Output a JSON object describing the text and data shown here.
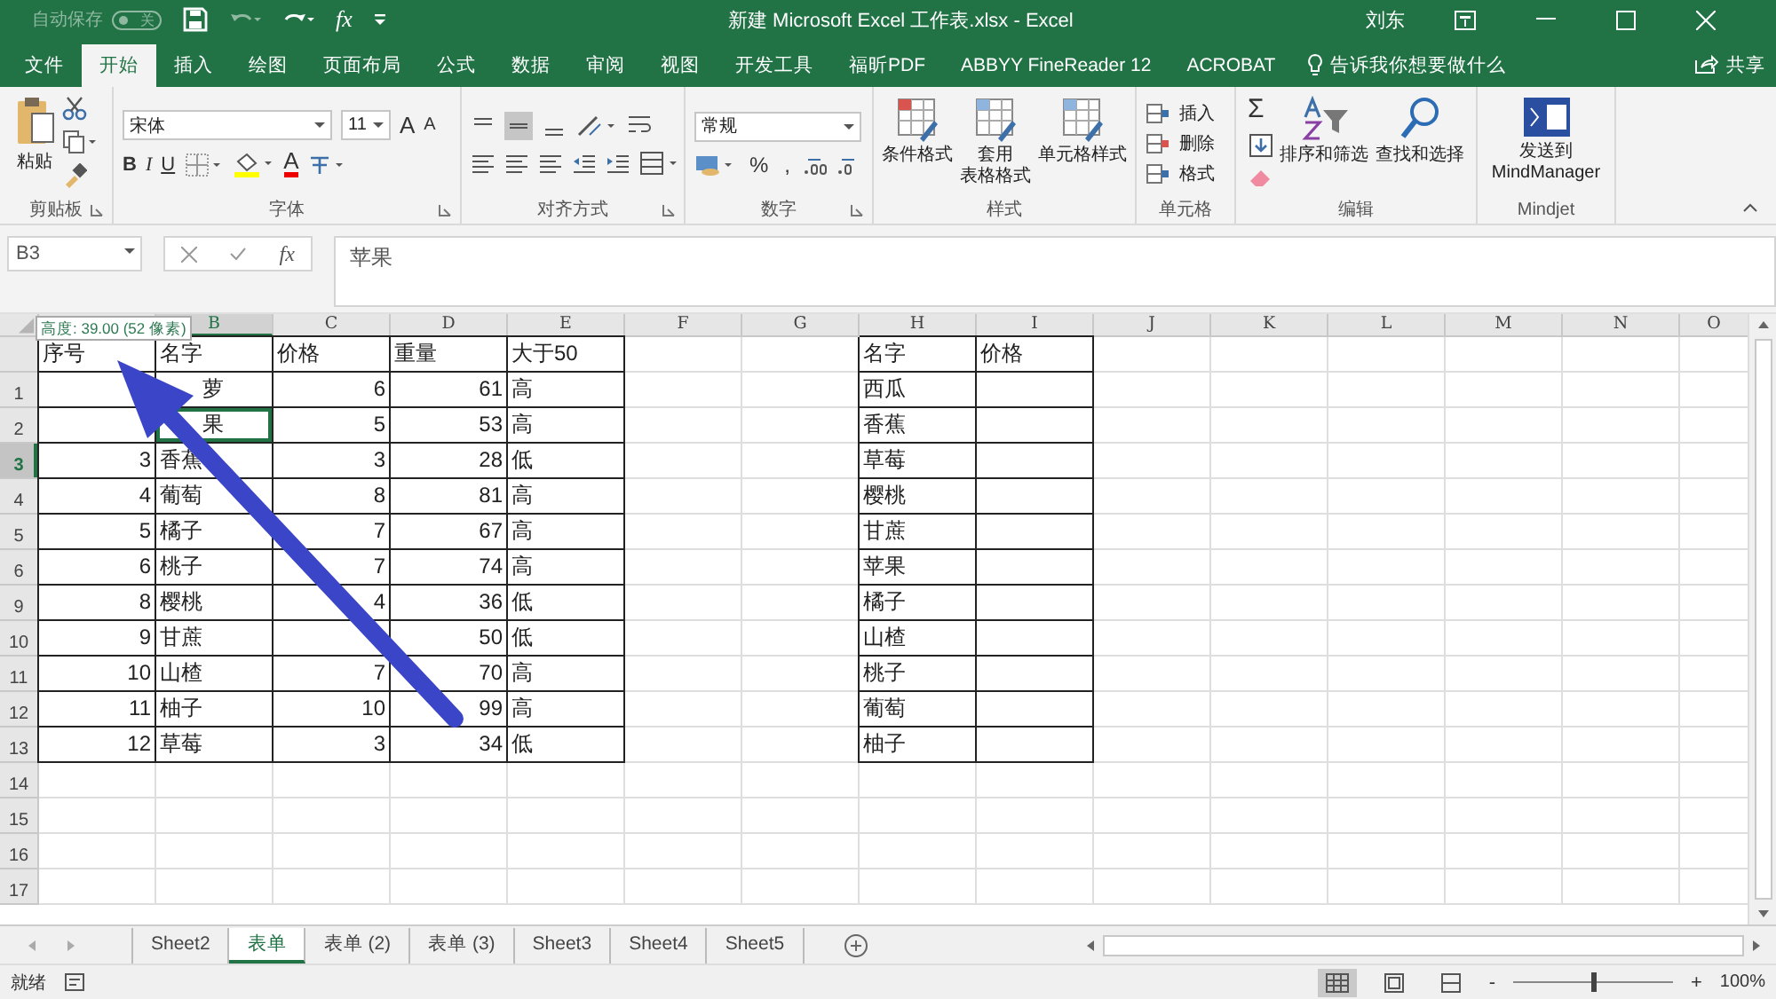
{
  "title_bar": {
    "autosave": {
      "label": "自动保存",
      "on": false,
      "switch_text": "关"
    },
    "fx": "fx",
    "title": "新建 Microsoft Excel 工作表.xlsx  -  Excel",
    "user": "刘东"
  },
  "ribbon_tabs": [
    {
      "label": "文件",
      "selected": false
    },
    {
      "label": "开始",
      "selected": true
    },
    {
      "label": "插入",
      "selected": false
    },
    {
      "label": "绘图",
      "selected": false
    },
    {
      "label": "页面布局",
      "selected": false
    },
    {
      "label": "公式",
      "selected": false
    },
    {
      "label": "数据",
      "selected": false
    },
    {
      "label": "审阅",
      "selected": false
    },
    {
      "label": "视图",
      "selected": false
    },
    {
      "label": "开发工具",
      "selected": false
    },
    {
      "label": "福昕PDF",
      "selected": false
    },
    {
      "label": "ABBYY FineReader 12",
      "selected": false
    },
    {
      "label": "ACROBAT",
      "selected": false
    }
  ],
  "tell_me": "告诉我你想要做什么",
  "share": "共享",
  "ribbon": {
    "clipboard": {
      "paste": "粘贴",
      "label": "剪贴板"
    },
    "font": {
      "name": "宋体",
      "size": "11",
      "grow": "A",
      "shrink": "A",
      "bold": "B",
      "italic": "I",
      "underline": "U",
      "font_color_letter": "A",
      "label": "字体"
    },
    "alignment": {
      "label": "对齐方式"
    },
    "number": {
      "format": "常规",
      "percent": "%",
      "comma": ",",
      "label": "数字"
    },
    "styles": {
      "items": [
        [
          "条件格式"
        ],
        [
          "套用",
          "表格格式"
        ],
        [
          "单元格样式"
        ]
      ],
      "label": "样式"
    },
    "cells": {
      "items": [
        "插入",
        "删除",
        "格式"
      ],
      "label": "单元格"
    },
    "editing": {
      "sum": "Σ",
      "items": [
        "排序和筛选",
        "查找和选择"
      ],
      "label": "编辑"
    },
    "mindjet": {
      "send": [
        "发送到",
        "MindManager"
      ],
      "label": "Mindjet"
    }
  },
  "formula_bar": {
    "name_box": "B3",
    "fx": "fx",
    "formula": "苹果"
  },
  "columns": [
    {
      "numeric": true,
      "selected": false
    },
    {
      "letter": "B",
      "numeric": false,
      "selected": true
    },
    {
      "letter": "C",
      "numeric": true,
      "selected": false
    },
    {
      "letter": "D",
      "numeric": true,
      "selected": false
    },
    {
      "letter": "E",
      "numeric": false,
      "selected": false
    },
    {
      "letter": "F",
      "selected": false
    },
    {
      "letter": "G",
      "selected": false
    },
    {
      "letter": "H",
      "numeric": false,
      "selected": false
    },
    {
      "letter": "I",
      "selected": false
    },
    {
      "letter": "J",
      "selected": false
    },
    {
      "letter": "K",
      "selected": false
    },
    {
      "letter": "L",
      "selected": false
    },
    {
      "letter": "M",
      "selected": false
    },
    {
      "letter": "N",
      "selected": false
    },
    {
      "letter": "O",
      "selected": false
    }
  ],
  "rows": [
    {
      "kind": "header",
      "cells": {
        "A": "序号",
        "B": "名字",
        "C": "价格",
        "D": "重量",
        "E": "大于50",
        "H": "名字",
        "I": "价格"
      }
    },
    {
      "kind": "data",
      "label": "1",
      "selected": false,
      "cells": {
        "B": {
          "text": "萝",
          "covered": true
        },
        "C": "6",
        "D": "61",
        "E": "高",
        "H": "西瓜"
      }
    },
    {
      "kind": "data",
      "label": "2",
      "selected": false,
      "cells": {
        "B": {
          "text": "果",
          "covered": true,
          "selected": true
        },
        "C": "5",
        "D": "53",
        "E": "高",
        "H": "香蕉"
      }
    },
    {
      "kind": "data",
      "label": "3",
      "selected": true,
      "cells": {
        "A": "3",
        "B": "香蕉",
        "C": "3",
        "D": "28",
        "E": "低",
        "H": "草莓"
      }
    },
    {
      "kind": "data",
      "label": "4",
      "selected": false,
      "cells": {
        "A": "4",
        "B": "葡萄",
        "C": "8",
        "D": "81",
        "E": "高",
        "H": "樱桃"
      }
    },
    {
      "kind": "data",
      "label": "5",
      "selected": false,
      "cells": {
        "A": "5",
        "B": "橘子",
        "C": "7",
        "D": "67",
        "E": "高",
        "H": "甘蔗"
      }
    },
    {
      "kind": "data",
      "label": "6",
      "selected": false,
      "cells": {
        "A": "6",
        "B": "桃子",
        "C": "7",
        "D": "74",
        "E": "高",
        "H": "苹果"
      }
    },
    {
      "kind": "data",
      "label": "9",
      "selected": false,
      "cells": {
        "A": "8",
        "B": "樱桃",
        "C": "4",
        "D": "36",
        "E": "低",
        "H": "橘子"
      }
    },
    {
      "kind": "data",
      "label": "10",
      "selected": false,
      "cells": {
        "A": "9",
        "B": "甘蔗",
        "C": {
          "covered": true
        },
        "D": "50",
        "E": "低",
        "H": "山楂"
      }
    },
    {
      "kind": "data",
      "label": "11",
      "selected": false,
      "cells": {
        "A": "10",
        "B": "山楂",
        "C": "7",
        "D": "70",
        "E": "高",
        "H": "桃子"
      }
    },
    {
      "kind": "data",
      "label": "12",
      "selected": false,
      "cells": {
        "A": "11",
        "B": "柚子",
        "C": "10",
        "D": "99",
        "E": "高",
        "H": "葡萄"
      }
    },
    {
      "kind": "data",
      "label": "13",
      "selected": false,
      "cells": {
        "A": "12",
        "B": "草莓",
        "C": "3",
        "D": "34",
        "E": "低",
        "H": "柚子"
      }
    },
    {
      "kind": "empty",
      "label": "14",
      "selected": false,
      "cells": {}
    },
    {
      "kind": "empty",
      "label": "15",
      "selected": false,
      "cells": {}
    },
    {
      "kind": "empty",
      "label": "16",
      "selected": false,
      "cells": {}
    },
    {
      "kind": "empty",
      "label": "17",
      "selected": false,
      "cells": {}
    }
  ],
  "tooltip": "高度: 39.00 (52 像素)",
  "sheet_tabs": [
    {
      "label": "Sheet2",
      "selected": false
    },
    {
      "label": "表单",
      "selected": true
    },
    {
      "label": "表单 (2)",
      "selected": false
    },
    {
      "label": "表单 (3)",
      "selected": false
    },
    {
      "label": "Sheet3",
      "selected": false
    },
    {
      "label": "Sheet4",
      "selected": false
    },
    {
      "label": "Sheet5",
      "selected": false
    }
  ],
  "status_bar": {
    "status": "就绪",
    "zoom": {
      "zoom_out": "-",
      "level": 0.5,
      "zoom_in": "+",
      "reading": "100%"
    }
  }
}
